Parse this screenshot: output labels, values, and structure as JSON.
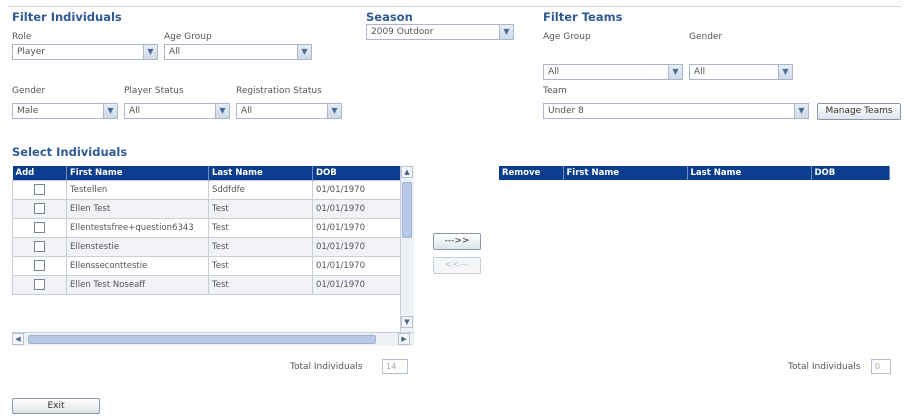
{
  "filter_individuals": {
    "title": "Filter Individuals",
    "role_label": "Role",
    "role_value": "Player",
    "age_group_label": "Age Group",
    "age_group_value": "All",
    "gender_label": "Gender",
    "gender_value": "Male",
    "player_status_label": "Player Status",
    "player_status_value": "All",
    "registration_status_label": "Registration Status",
    "registration_status_value": "All"
  },
  "season": {
    "title": "Season",
    "value": "2009 Outdoor"
  },
  "filter_teams": {
    "title": "Filter Teams",
    "age_group_label": "Age Group",
    "age_group_value": "All",
    "gender_label": "Gender",
    "gender_value": "All",
    "team_label": "Team",
    "team_value": "Under 8",
    "manage_teams_label": "Manage Teams"
  },
  "select_individuals": {
    "title": "Select Individuals",
    "headers": [
      "Add",
      "First Name",
      "Last Name",
      "DOB"
    ],
    "rows": [
      {
        "first": "Testellen",
        "last": "Sddfdfe",
        "dob": "01/01/1970"
      },
      {
        "first": "Ellen Test",
        "last": "Test",
        "dob": "01/01/1970"
      },
      {
        "first": "Ellentestsfree+question6343",
        "last": "Test",
        "dob": "01/01/1970"
      },
      {
        "first": "Ellenstestie",
        "last": "Test",
        "dob": "01/01/1970"
      },
      {
        "first": "Ellensseconttestie",
        "last": "Test",
        "dob": "01/01/1970"
      },
      {
        "first": "Ellen Test Noseaff",
        "last": "Test",
        "dob": "01/01/1970"
      }
    ],
    "total_label": "Total Individuals",
    "total_value": "14"
  },
  "transfer": {
    "add_label": "--->>",
    "remove_label": "<<---"
  },
  "team_roster": {
    "headers": [
      "Remove",
      "First Name",
      "Last Name",
      "DOB"
    ],
    "total_label": "Total Individuals",
    "total_value": "0"
  },
  "exit_label": "Exit"
}
